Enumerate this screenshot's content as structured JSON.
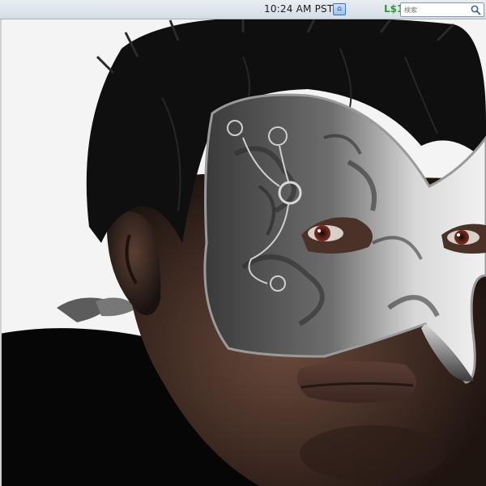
{
  "statusbar": {
    "clock": "10:24 AM PST",
    "balance": "L$1",
    "search_placeholder": "検索"
  },
  "icons": {
    "region_icon": "sl-region-icon",
    "search_icon": "magnifier-icon"
  },
  "colors": {
    "balance_green": "#2f9a2f",
    "statusbar_bg": "#dde4eb",
    "mask_silver": "#c8c8c8",
    "hair_black": "#111111",
    "skin_dark": "#4a3228"
  }
}
